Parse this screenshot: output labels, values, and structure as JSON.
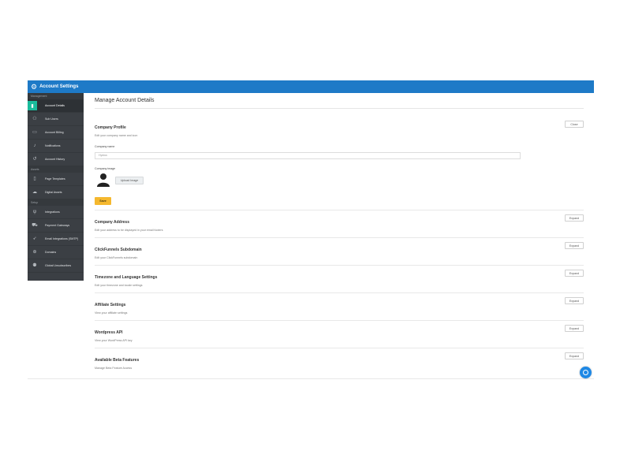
{
  "header": {
    "title": "Account Settings",
    "icon": "gear-icon"
  },
  "sidebar": {
    "sections": [
      {
        "label": "Management",
        "items": [
          {
            "label": "Account Details",
            "icon": "bookmark-icon",
            "active": true
          },
          {
            "label": "Sub Users",
            "icon": "users-icon"
          },
          {
            "label": "Account Billing",
            "icon": "credit-card-icon"
          },
          {
            "label": "Notifications",
            "icon": "bell-icon"
          },
          {
            "label": "Account History",
            "icon": "history-icon"
          }
        ]
      },
      {
        "label": "Assets",
        "items": [
          {
            "label": "Page Templates",
            "icon": "file-icon"
          },
          {
            "label": "Digital Assets",
            "icon": "cloud-icon"
          }
        ]
      },
      {
        "label": "Setup",
        "items": [
          {
            "label": "Integrations",
            "icon": "plug-icon"
          },
          {
            "label": "Payment Gateways",
            "icon": "cart-icon"
          },
          {
            "label": "Email Integrations (SMTP)",
            "icon": "paper-plane-icon"
          },
          {
            "label": "Domains",
            "icon": "globe-icon"
          },
          {
            "label": "Global Unsubscribes",
            "icon": "user-minus-icon"
          }
        ]
      }
    ]
  },
  "main": {
    "title": "Manage Account Details",
    "company_profile": {
      "title": "Company Profile",
      "subtitle": "Edit your company name and icon",
      "collapse_label": "Close",
      "name_label": "Company name",
      "name_value": "Hystus",
      "image_label": "Company image",
      "upload_label": "Upload Image",
      "save_label": "Save"
    },
    "sections": [
      {
        "title": "Company Address",
        "subtitle": "Edit your address to be displayed in your email footers",
        "button": "Expand"
      },
      {
        "title": "ClickFunnels Subdomain",
        "subtitle": "Edit your ClickFunnels subdomain",
        "button": "Expand"
      },
      {
        "title": "Timezone and Language Settings",
        "subtitle": "Edit your timezone and locale settings",
        "button": "Expand"
      },
      {
        "title": "Affiliate Settings",
        "subtitle": "View your affiliate settings",
        "button": "Expand"
      },
      {
        "title": "Wordpress API",
        "subtitle": "View your WordPress API key",
        "button": "Expand"
      },
      {
        "title": "Available Beta Features",
        "subtitle": "Manage Beta Feature Access",
        "button": "Expand"
      }
    ]
  },
  "colors": {
    "topbar": "#1e7ac7",
    "sidebar": "#3b3f44",
    "active_accent": "#1abc9c",
    "save_button": "#f5b82e",
    "chat_bubble": "#1e88e5"
  }
}
